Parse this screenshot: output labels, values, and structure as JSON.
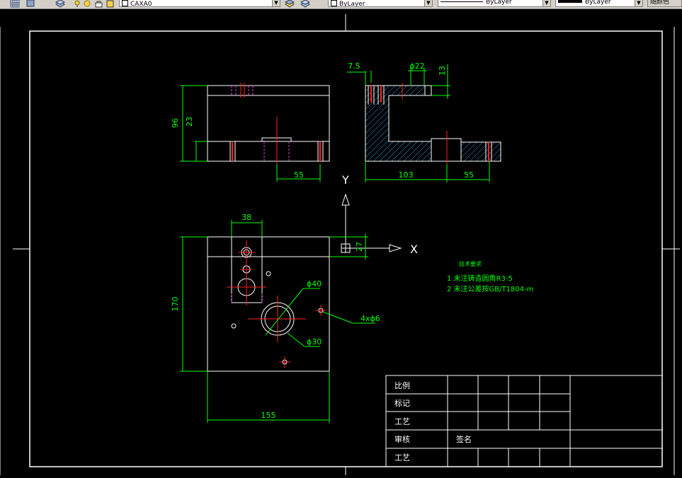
{
  "toolbar": {
    "layer_name": "CAXA0",
    "color_value": "ByLayer",
    "linetype_value": "ByLayer",
    "lineweight_value": "ByLayer",
    "plotstyle_label": "随颜色"
  },
  "drawing": {
    "dims": {
      "d96": "96",
      "d23": "23",
      "d55_front": "55",
      "d7_5": "7.5",
      "dphi22": "ϕ22",
      "d13": "13",
      "d103": "103",
      "d55_side": "55",
      "d38": "38",
      "d27": "27",
      "d170": "170",
      "d155": "155",
      "dphi40": "ϕ40",
      "dphi30": "ϕ30",
      "d4xphi6": "4xϕ6"
    },
    "axis": {
      "y": "Y",
      "x": "X"
    },
    "notes": {
      "title": "技术要求",
      "line1": "1 未注铸造圆角R3-5",
      "line2": "2 未注公差按GB/T1804-m"
    },
    "title_block": {
      "r1": "比例",
      "r2": "标记",
      "r3": "工艺",
      "r4": "审核",
      "r4_name": "签名",
      "r5": "工艺"
    }
  }
}
